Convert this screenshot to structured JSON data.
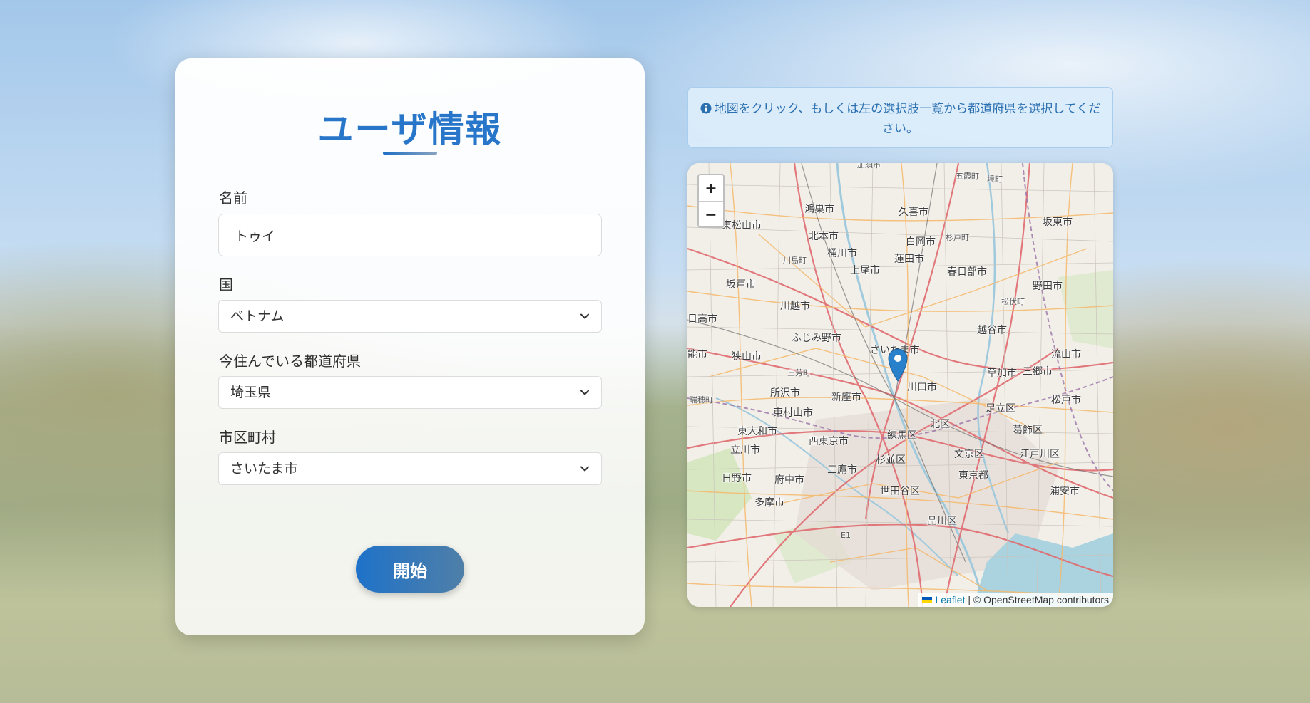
{
  "form": {
    "title": "ユーザ情報",
    "name_label": "名前",
    "name_value": "トゥイ",
    "country_label": "国",
    "country_value": "ベトナム",
    "prefecture_label": "今住んでいる都道府県",
    "prefecture_value": "埼玉県",
    "city_label": "市区町村",
    "city_value": "さいたま市",
    "start_button": "開始"
  },
  "info": {
    "icon": "info-circle-icon",
    "text": "地図をクリック、もしくは左の選択肢一覧から都道府県を選択してください。"
  },
  "map": {
    "zoom_in": "+",
    "zoom_out": "−",
    "labels": {
      "konosu": "鴻巣市",
      "kuki": "久喜市",
      "satte": "五霞町",
      "higashimatsuyama": "東松山市",
      "kitamoto": "北本市",
      "shiraoka": "白岡市",
      "sakado_town": "杉戸町",
      "bando": "坂東市",
      "okegawa": "桶川市",
      "hasuda": "蓮田市",
      "ageo": "上尾市",
      "kasukabe": "春日部市",
      "sakado": "坂戸市",
      "noda": "野田市",
      "kawagoe": "川越市",
      "fujimino": "ふじみ野市",
      "koshigaya": "越谷市",
      "saitama": "さいたま市",
      "hidaka": "日高市",
      "sayama": "狭山市",
      "nagareyama": "流山市",
      "soka": "草加市",
      "misato": "三郷市",
      "kawaguchi": "川口市",
      "tokorozawa": "所沢市",
      "niiza": "新座市",
      "matsudo": "松戸市",
      "adachi": "足立区",
      "higashimurayama": "東村山市",
      "kita": "北区",
      "katsushika": "葛飾区",
      "higashiyamato": "東大和市",
      "nishitokyo": "西東京市",
      "nerima": "練馬区",
      "tachikawa": "立川市",
      "bunkyo": "文京区",
      "edogawa": "江戸川区",
      "suginami": "杉並区",
      "hino": "日野市",
      "fuchu": "府中市",
      "mitaka": "三鷹市",
      "tokyo": "東京都",
      "tama": "多摩市",
      "setagaya": "世田谷区",
      "urayasu": "浦安市",
      "shinagawa": "品川区",
      "iruma_small": "入間市",
      "kawajima": "川島町",
      "miyoshi": "三芳町",
      "mizuho": "瑞穂町",
      "matsubushi": "松伏町",
      "kazo": "加須市",
      "sakai": "境町",
      "hanno": "能市",
      "e1": "E1"
    },
    "attribution_link": "Leaflet",
    "attribution_text": "| © OpenStreetMap contributors"
  }
}
